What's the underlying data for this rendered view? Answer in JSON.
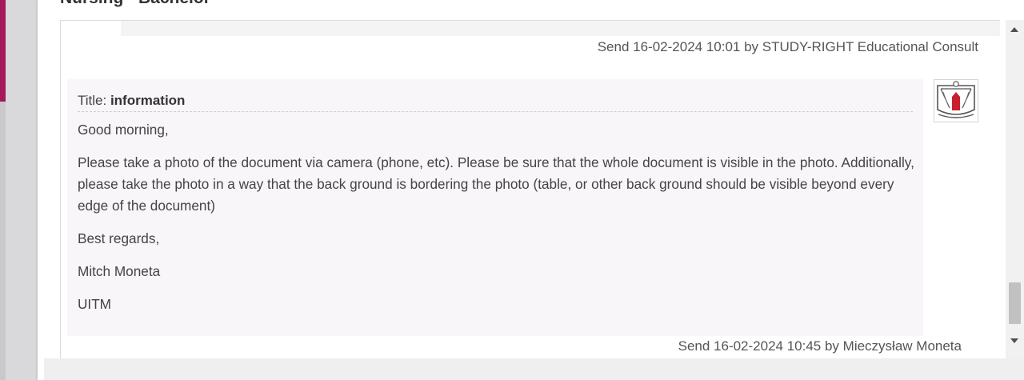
{
  "page": {
    "title": "Nursing - Bachelor"
  },
  "thread": {
    "previous_message_sent": "Send 16-02-2024 10:01 by STUDY-RIGHT Educational Consult",
    "message": {
      "title_label": "Title:",
      "title_value": "information",
      "paragraphs": [
        "Good morning,",
        "Please take a photo of the document via camera (phone, etc). Please be sure that the whole document is visible in the photo. Additionally, please take the photo in a way that the back ground is bordering the photo (table, or other back ground should be visible beyond every edge of the document)",
        "Best regards,",
        "Mitch Moneta",
        "UITM"
      ],
      "sent": "Send 16-02-2024 10:45 by Mieczysław Moneta",
      "avatar_icon": "university-crest-icon"
    }
  },
  "colors": {
    "brand_accent": "#a3195b",
    "logo_red": "#c8202f",
    "message_background": "#f8f6f8"
  }
}
